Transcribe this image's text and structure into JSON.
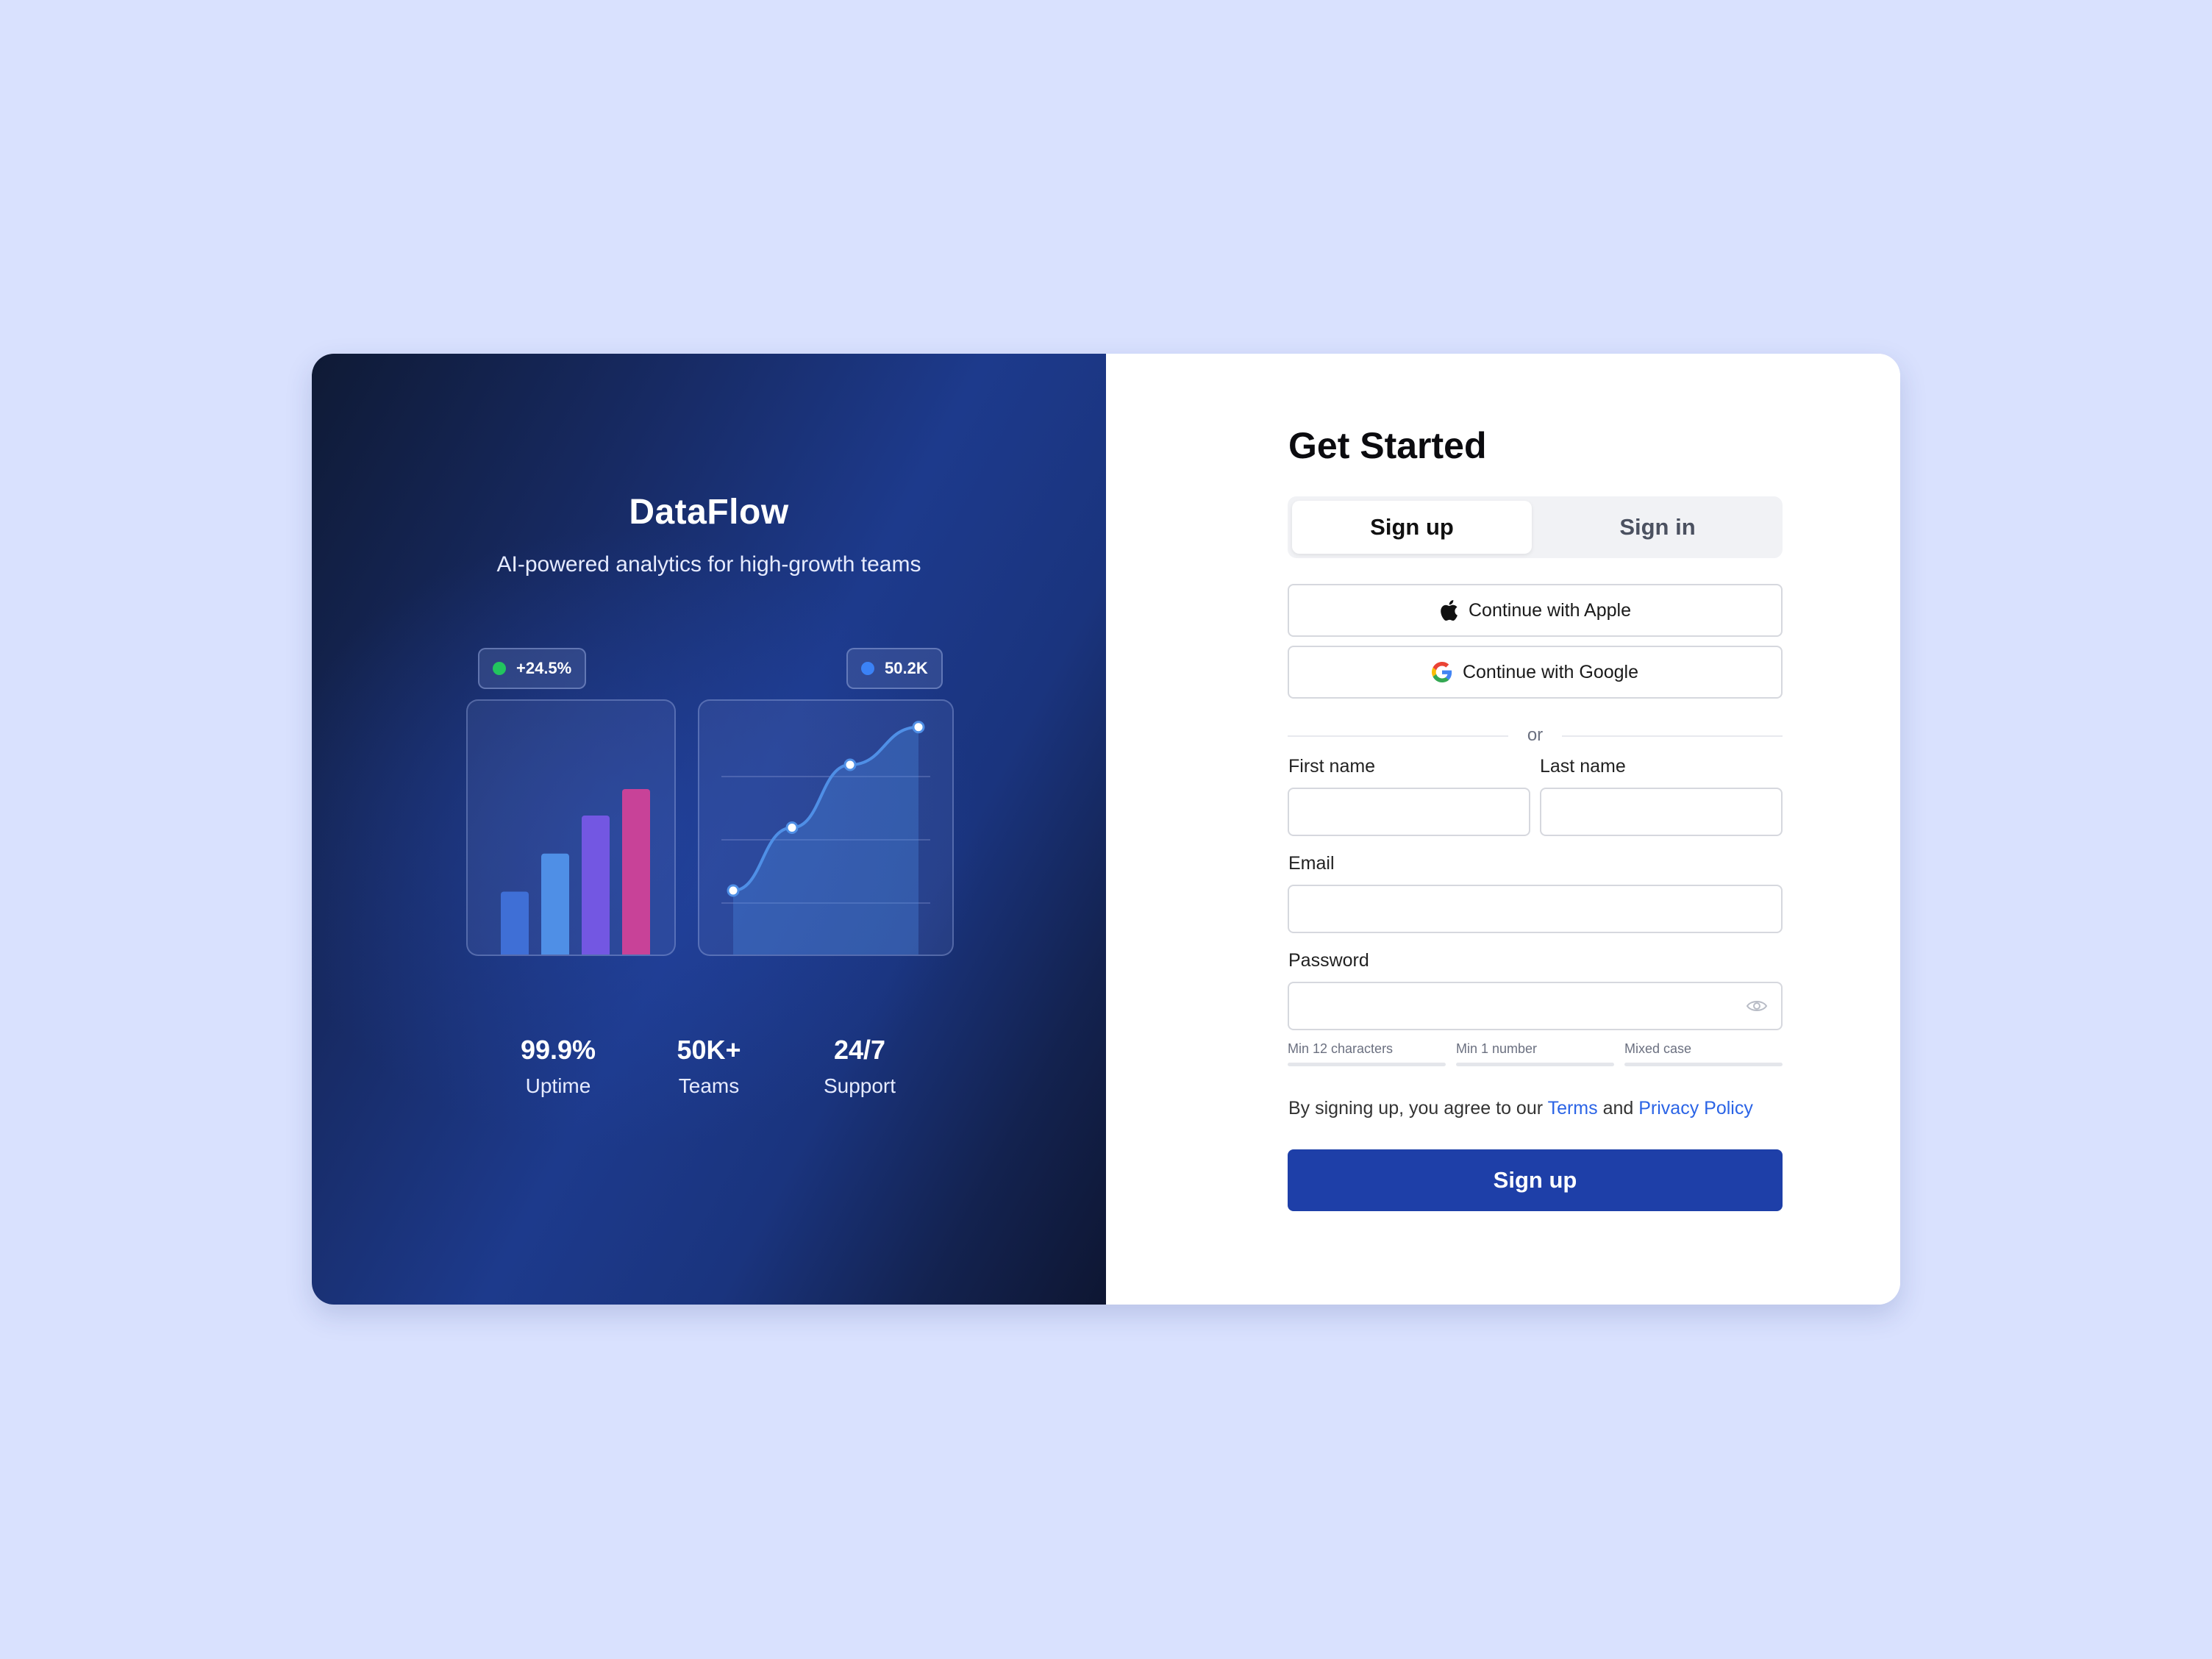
{
  "hero": {
    "brand": "DataFlow",
    "tagline": "AI-powered analytics for high-growth teams",
    "badges": [
      {
        "value": "+24.5%",
        "dot_color": "#22c55e"
      },
      {
        "value": "50.2K",
        "dot_color": "#3b82f6"
      }
    ],
    "bar_chart": {
      "values": [
        0.38,
        0.61,
        0.84,
        1.0
      ],
      "colors": [
        "#3f6fd6",
        "#4f8fe6",
        "#7357e2",
        "#c84298"
      ]
    },
    "line_chart": {
      "values": [
        0.2,
        0.5,
        0.8,
        0.98
      ],
      "color": "#4f8fe6"
    },
    "stats": [
      {
        "value": "99.9%",
        "label": "Uptime"
      },
      {
        "value": "50K+",
        "label": "Teams"
      },
      {
        "value": "24/7",
        "label": "Support"
      }
    ]
  },
  "form": {
    "title": "Get Started",
    "tabs": [
      {
        "label": "Sign up",
        "active": true
      },
      {
        "label": "Sign in",
        "active": false
      }
    ],
    "sso": {
      "apple": "Continue with Apple",
      "google": "Continue with Google"
    },
    "divider": "or",
    "fields": {
      "first_name": {
        "label": "First name",
        "value": "",
        "placeholder": ""
      },
      "last_name": {
        "label": "Last name",
        "value": "",
        "placeholder": ""
      },
      "email": {
        "label": "Email",
        "value": "",
        "placeholder": ""
      },
      "password": {
        "label": "Password",
        "value": "",
        "placeholder": ""
      }
    },
    "password_hints": [
      "Min 12 characters",
      "Min 1 number",
      "Mixed case"
    ],
    "legal": {
      "prefix": "By signing up, you agree to our",
      "terms": "Terms",
      "and": "and",
      "privacy": "Privacy Policy"
    },
    "submit": "Sign up"
  },
  "colors": {
    "page_bg": "#d9e1fe",
    "accent": "#1e3fa8",
    "link": "#2b64e6"
  }
}
